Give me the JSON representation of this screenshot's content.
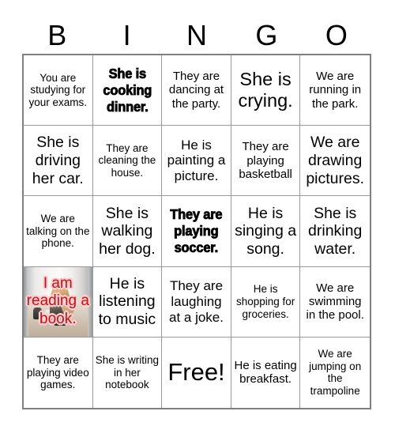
{
  "card": {
    "header_letters": [
      "B",
      "I",
      "N",
      "G",
      "O"
    ],
    "columns": 5,
    "rows": 5,
    "colors": {
      "background": "#ffffff",
      "text": "#000000",
      "grid_outer_border": "#808080",
      "grid_inner_line": "#9a9a9a",
      "photo_cell_text": "#b3191c",
      "photo_cell_text_outline": "#ffc9cc"
    }
  },
  "cells": [
    {
      "id": "b1",
      "text": "You are studying for your exams.",
      "size": "xs",
      "style": "normal"
    },
    {
      "id": "i1",
      "text": "She is cooking dinner.",
      "size": "m",
      "style": "bold"
    },
    {
      "id": "n1",
      "text": "They are dancing at the party.",
      "size": "s",
      "style": "normal"
    },
    {
      "id": "g1",
      "text": "She is crying.",
      "size": "xl",
      "style": "normal"
    },
    {
      "id": "o1",
      "text": "We are running in the park.",
      "size": "s",
      "style": "normal"
    },
    {
      "id": "b2",
      "text": "She is driving her car.",
      "size": "l",
      "style": "normal"
    },
    {
      "id": "i2",
      "text": "They are cleaning the house.",
      "size": "xs",
      "style": "normal"
    },
    {
      "id": "n2",
      "text": "He is painting a picture.",
      "size": "m",
      "style": "normal"
    },
    {
      "id": "g2",
      "text": "They are playing basketball",
      "size": "s",
      "style": "normal"
    },
    {
      "id": "o2",
      "text": "We are drawing pictures.",
      "size": "l",
      "style": "normal"
    },
    {
      "id": "b3",
      "text": "We are talking on the phone.",
      "size": "xs",
      "style": "normal"
    },
    {
      "id": "i3",
      "text": "She is walking her dog.",
      "size": "l",
      "style": "normal"
    },
    {
      "id": "n3",
      "text": "They are playing soccer.",
      "size": "m",
      "style": "bold"
    },
    {
      "id": "g3",
      "text": "He is singing a song.",
      "size": "l",
      "style": "normal"
    },
    {
      "id": "o3",
      "text": "She is drinking water.",
      "size": "l",
      "style": "normal"
    },
    {
      "id": "b4",
      "text": "I am reading a book.",
      "size": "m",
      "style": "photo"
    },
    {
      "id": "i4",
      "text": "He is listening to music",
      "size": "l",
      "style": "normal"
    },
    {
      "id": "n4",
      "text": "They are laughing at a joke.",
      "size": "m",
      "style": "normal"
    },
    {
      "id": "g4",
      "text": "He is shopping for groceries.",
      "size": "xs",
      "style": "normal"
    },
    {
      "id": "o4",
      "text": "We are swimming in the pool.",
      "size": "s",
      "style": "normal"
    },
    {
      "id": "b5",
      "text": "They are playing video games.",
      "size": "xs",
      "style": "normal"
    },
    {
      "id": "i5",
      "text": "She is writing in her notebook",
      "size": "xs",
      "style": "normal"
    },
    {
      "id": "n5",
      "text": "Free!",
      "size": "xxl",
      "style": "normal"
    },
    {
      "id": "g5",
      "text": "He is eating breakfast.",
      "size": "s",
      "style": "normal"
    },
    {
      "id": "o5",
      "text": "We are jumping on the trampoline",
      "size": "xs",
      "style": "normal"
    }
  ]
}
